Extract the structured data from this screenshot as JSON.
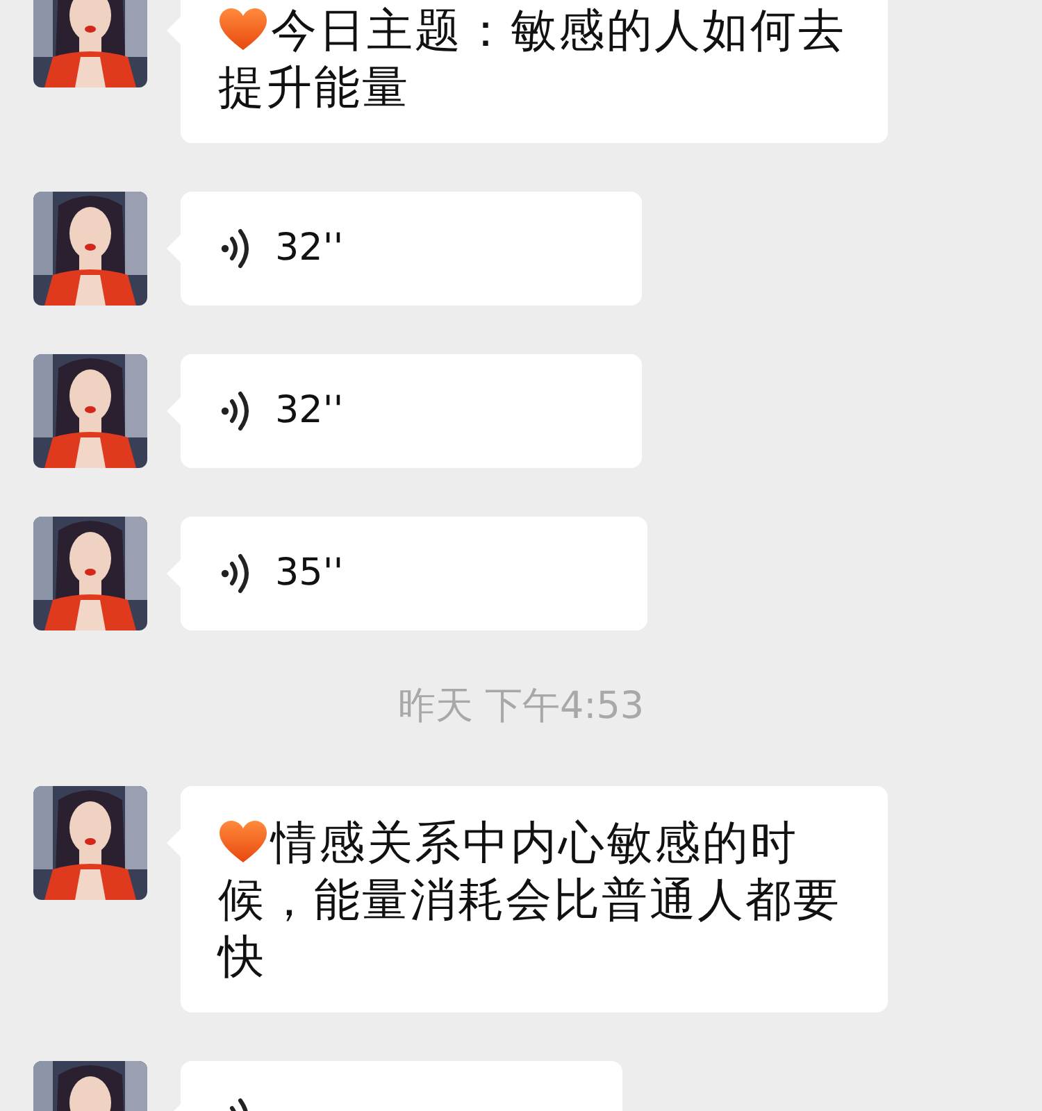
{
  "messages": [
    {
      "kind": "text",
      "heart": true,
      "text": "今日主题：敏感的人如何去提升能量"
    },
    {
      "kind": "voice",
      "duration": "32''"
    },
    {
      "kind": "voice",
      "duration": "32''"
    },
    {
      "kind": "voice",
      "duration": "35''"
    },
    {
      "kind": "time",
      "text": "昨天 下午4:53"
    },
    {
      "kind": "text",
      "heart": true,
      "text": "情感关系中内心敏感的时候，能量消耗会比普通人都要快"
    },
    {
      "kind": "voice"
    }
  ]
}
